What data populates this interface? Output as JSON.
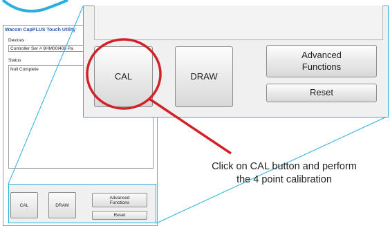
{
  "utility": {
    "title": "Wacom CapPLUS Touch Utility",
    "devices_label": "Devices",
    "device_value": "Controller Ser # 9HM00I400  Pa",
    "status_label": "Status",
    "status_value": "Null Complete",
    "buttons": {
      "cal": "CAL",
      "draw": "DRAW",
      "advanced_line1": "Advanced",
      "advanced_line2": "Functions",
      "reset": "Reset"
    }
  },
  "zoom": {
    "cal": "CAL",
    "draw": "DRAW",
    "advanced_line1": "Advanced",
    "advanced_line2": "Functions",
    "reset": "Reset"
  },
  "callout": {
    "line1": "Click on CAL button and perform",
    "line2": "the 4 point calibration"
  },
  "colors": {
    "accent_cyan": "#29aee0",
    "highlight_red": "#d22027",
    "title_blue": "#2a5aa8"
  }
}
